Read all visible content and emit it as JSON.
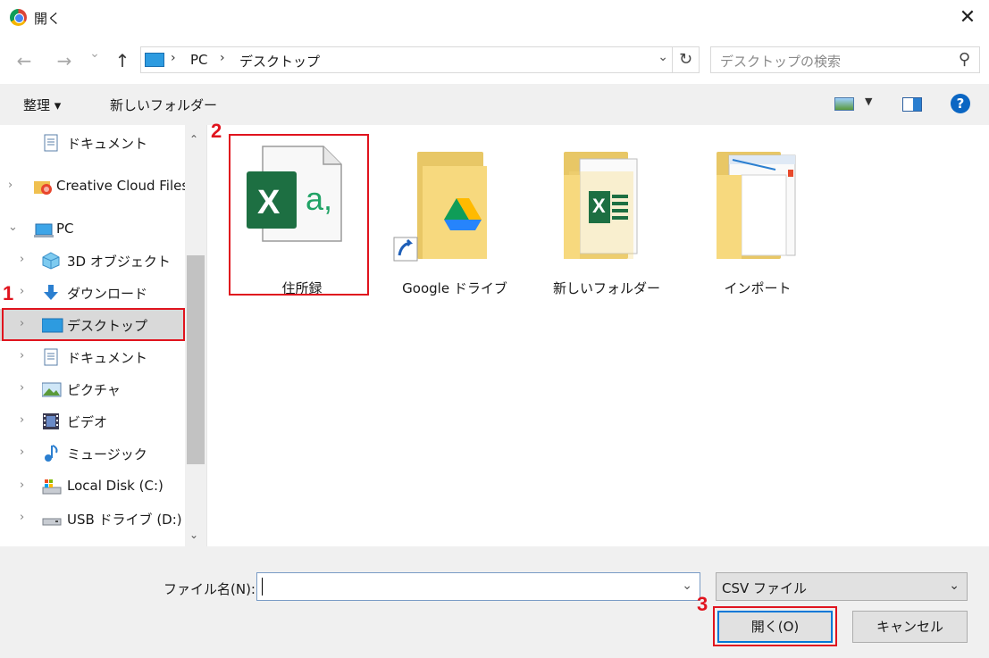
{
  "window": {
    "title": "開く",
    "close_glyph": "✕"
  },
  "nav": {
    "back": "←",
    "forward": "→",
    "recent": "⌄",
    "up": "↑"
  },
  "address": {
    "crumbs": [
      "PC",
      "デスクトップ"
    ],
    "separator": "›",
    "dropdown": "⌄",
    "refresh": "↻"
  },
  "search": {
    "placeholder": "デスクトップの検索",
    "icon": "search-icon"
  },
  "toolbar": {
    "organize": "整理 ▾",
    "new_folder": "新しいフォルダー",
    "help": "?"
  },
  "sidebar": {
    "items": [
      {
        "label": "ドキュメント",
        "icon": "documents-icon",
        "chevron": ""
      },
      {
        "label": "Creative Cloud Files",
        "icon": "creative-cloud-icon",
        "chevron": "›"
      },
      {
        "label": "PC",
        "icon": "pc-icon",
        "chevron": "⌄"
      },
      {
        "label": "3D オブジェクト",
        "icon": "3d-objects-icon",
        "chevron": "›"
      },
      {
        "label": "ダウンロード",
        "icon": "download-icon",
        "chevron": "›"
      },
      {
        "label": "デスクトップ",
        "icon": "desktop-icon",
        "chevron": "›",
        "selected": true
      },
      {
        "label": "ドキュメント",
        "icon": "documents-icon",
        "chevron": "›"
      },
      {
        "label": "ピクチャ",
        "icon": "pictures-icon",
        "chevron": "›"
      },
      {
        "label": "ビデオ",
        "icon": "video-icon",
        "chevron": "›"
      },
      {
        "label": "ミュージック",
        "icon": "music-icon",
        "chevron": "›"
      },
      {
        "label": "Local Disk (C:)",
        "icon": "local-disk-icon",
        "chevron": "›"
      },
      {
        "label": "USB ドライブ (D:)",
        "icon": "usb-drive-icon",
        "chevron": "›"
      }
    ],
    "scroll_up": "⌃",
    "scroll_down": "⌄"
  },
  "files": [
    {
      "name": "住所録",
      "icon": "excel-csv-icon",
      "icon_text": "X",
      "icon_sub": "a,"
    },
    {
      "name": "Google ドライブ",
      "icon": "google-drive-folder-icon"
    },
    {
      "name": "新しいフォルダー",
      "icon": "folder-excel-icon",
      "icon_text": "X"
    },
    {
      "name": "インポート",
      "icon": "folder-document-icon"
    }
  ],
  "bottom": {
    "filename_label": "ファイル名(N):",
    "filename_value": "",
    "filetype": "CSV ファイル",
    "dropdown": "⌄",
    "open_label": "開く(O)",
    "cancel_label": "キャンセル"
  },
  "annotations": {
    "step1": "1",
    "step2": "2",
    "step3": "3"
  },
  "colors": {
    "highlight": "#e0141e",
    "excel_green": "#1d6f42",
    "folder": "#f7d97e",
    "accent": "#0078d7"
  }
}
